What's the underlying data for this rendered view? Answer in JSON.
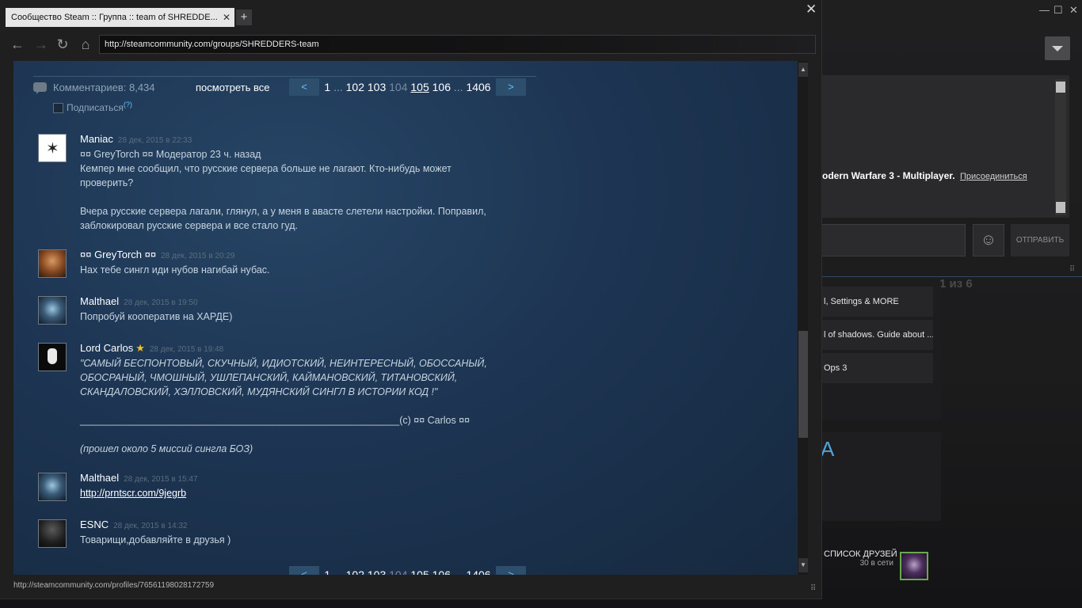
{
  "background_window": {
    "status_game": "odern Warfare 3 - Multiplayer.",
    "status_join": "Присоединиться",
    "send_label": "ОТПРАВИТЬ",
    "emoji_glyph": "☺",
    "pager_label": "1 из 6",
    "guides": [
      "l, Settings & MORE",
      "l of shadows. Guide about ...",
      "Ops 3"
    ],
    "banner_text": "A",
    "friends_title": "СПИСОК ДРУЗЕЙ",
    "friends_online": "30 в сети",
    "controls": {
      "minimize": "—",
      "maximize": "☐",
      "close": "✕"
    }
  },
  "browser": {
    "tab_title": "Сообщество Steam :: Группа :: team of SHREDDE...",
    "tab_close": "✕",
    "new_tab": "+",
    "window_close": "✕",
    "nav": {
      "back": "←",
      "forward": "→",
      "reload": "↻",
      "home": "⌂"
    },
    "url": "http://steamcommunity.com/groups/SHREDDERS-team",
    "status_url": "http://steamcommunity.com/profiles/76561198028172759",
    "scroll_up": "▲",
    "scroll_down": "▼",
    "resize_grip": "⠿"
  },
  "comments": {
    "count_label": "Комментариев: 8,434",
    "view_all": "посмотреть все",
    "subscribe_label": "Подписаться",
    "subscribe_help": "(?)",
    "pager": {
      "prev": "<",
      "next": ">",
      "first": "1",
      "ellipsis": "...",
      "p102": "102",
      "p103": "103",
      "p104": "104",
      "p105": "105",
      "p106": "106",
      "last": "1406"
    },
    "items": [
      {
        "author": "Maniac",
        "time": "28 дек, 2015 в 22:33",
        "text": "¤¤ GreyTorch ¤¤ Модератор 23 ч. назад\nКемпер мне сообщил, что русские сервера больше не лагают. Кто-нибудь может\nпроверить?\n\nВчера русские сервера лагали, глянул, а у меня в авасте слетели настройки. Поправил,\nзаблокировал русские сервера и все стало гуд."
      },
      {
        "author": "¤¤ GreyTorch ¤¤",
        "time": "28 дек, 2015 в 20:29",
        "text": "Нах тебе сингл иди нубов нагибай нубас."
      },
      {
        "author": "Malthael",
        "time": "28 дек, 2015 в 19:50",
        "text": "Попробуй кооператив на ХАРДЕ)"
      },
      {
        "author": "Lord Carlos",
        "star": "★",
        "time": "28 дек, 2015 в 19:48",
        "text_quote": "\"САМЫЙ БЕСПОНТОВЫЙ, СКУЧНЫЙ, ИДИОТСКИЙ, НЕИНТЕРЕСНЫЙ, ОБОССАНЫЙ,\nОБОСРАНЫЙ, ЧМОШНЫЙ, УШЛЕПАНСКИЙ, КАЙМАНОВСКИЙ, ТИТАНОВСКИЙ,\nСКАНДАЛОВСКИЙ, ХЭЛЛОВСКИЙ, МУДЯНСКИЙ СИНГЛ В ИСТОРИИ КОД !\"",
        "text_sign": "__________________________________________________________(c) ¤¤ Carlos ¤¤",
        "text_note": "(прошел около 5 миссий сингла БОЗ)"
      },
      {
        "author": "Malthael",
        "time": "28 дек, 2015 в 15:47",
        "link": "http://prntscr.com/9jegrb"
      },
      {
        "author": "ESNC",
        "time": "28 дек, 2015 в 14:32",
        "text": "Товарищи,добавляйте в друзья )"
      }
    ]
  }
}
